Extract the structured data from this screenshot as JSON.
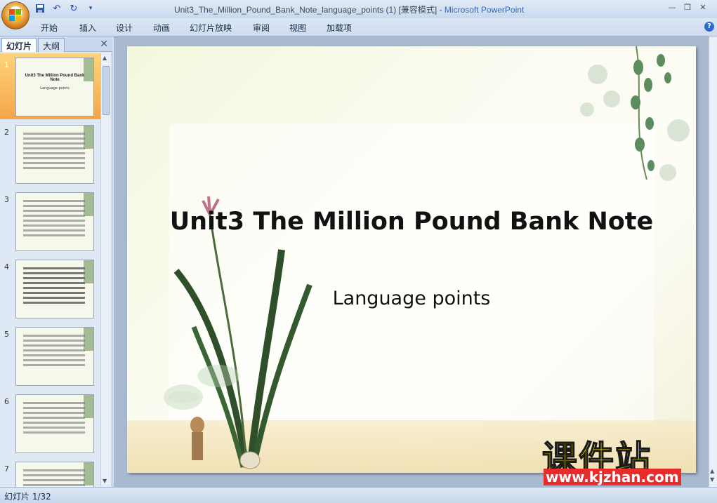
{
  "window": {
    "title": "Unit3_The_Million_Pound_Bank_Note_language_points (1) [兼容模式]",
    "separator": " - ",
    "app_name": "Microsoft PowerPoint"
  },
  "ribbon": {
    "tabs": [
      "开始",
      "插入",
      "设计",
      "动画",
      "幻灯片放映",
      "审阅",
      "视图",
      "加载项"
    ]
  },
  "left_pane": {
    "tabs": [
      "幻灯片",
      "大纲"
    ],
    "active_tab": "幻灯片",
    "thumbnails": [
      {
        "number": "1",
        "title": "Unit3 The Million  Pound  Bank  Note",
        "subtitle": "Language points",
        "selected": true
      },
      {
        "number": "2"
      },
      {
        "number": "3"
      },
      {
        "number": "4"
      },
      {
        "number": "5"
      },
      {
        "number": "6"
      },
      {
        "number": "7"
      }
    ]
  },
  "slide": {
    "title": "Unit3 The Million Pound Bank Note",
    "subtitle": "Language points"
  },
  "status": {
    "slide_indicator": "幻灯片 1/32"
  },
  "watermark": {
    "chinese": "课件站",
    "url": "www.kjzhan.com"
  },
  "colors": {
    "app_name": "#3a66b2",
    "selected_thumb": "#f5a54a",
    "watermark_text": "#f5e600",
    "watermark_url_bg": "#e82c2c"
  }
}
